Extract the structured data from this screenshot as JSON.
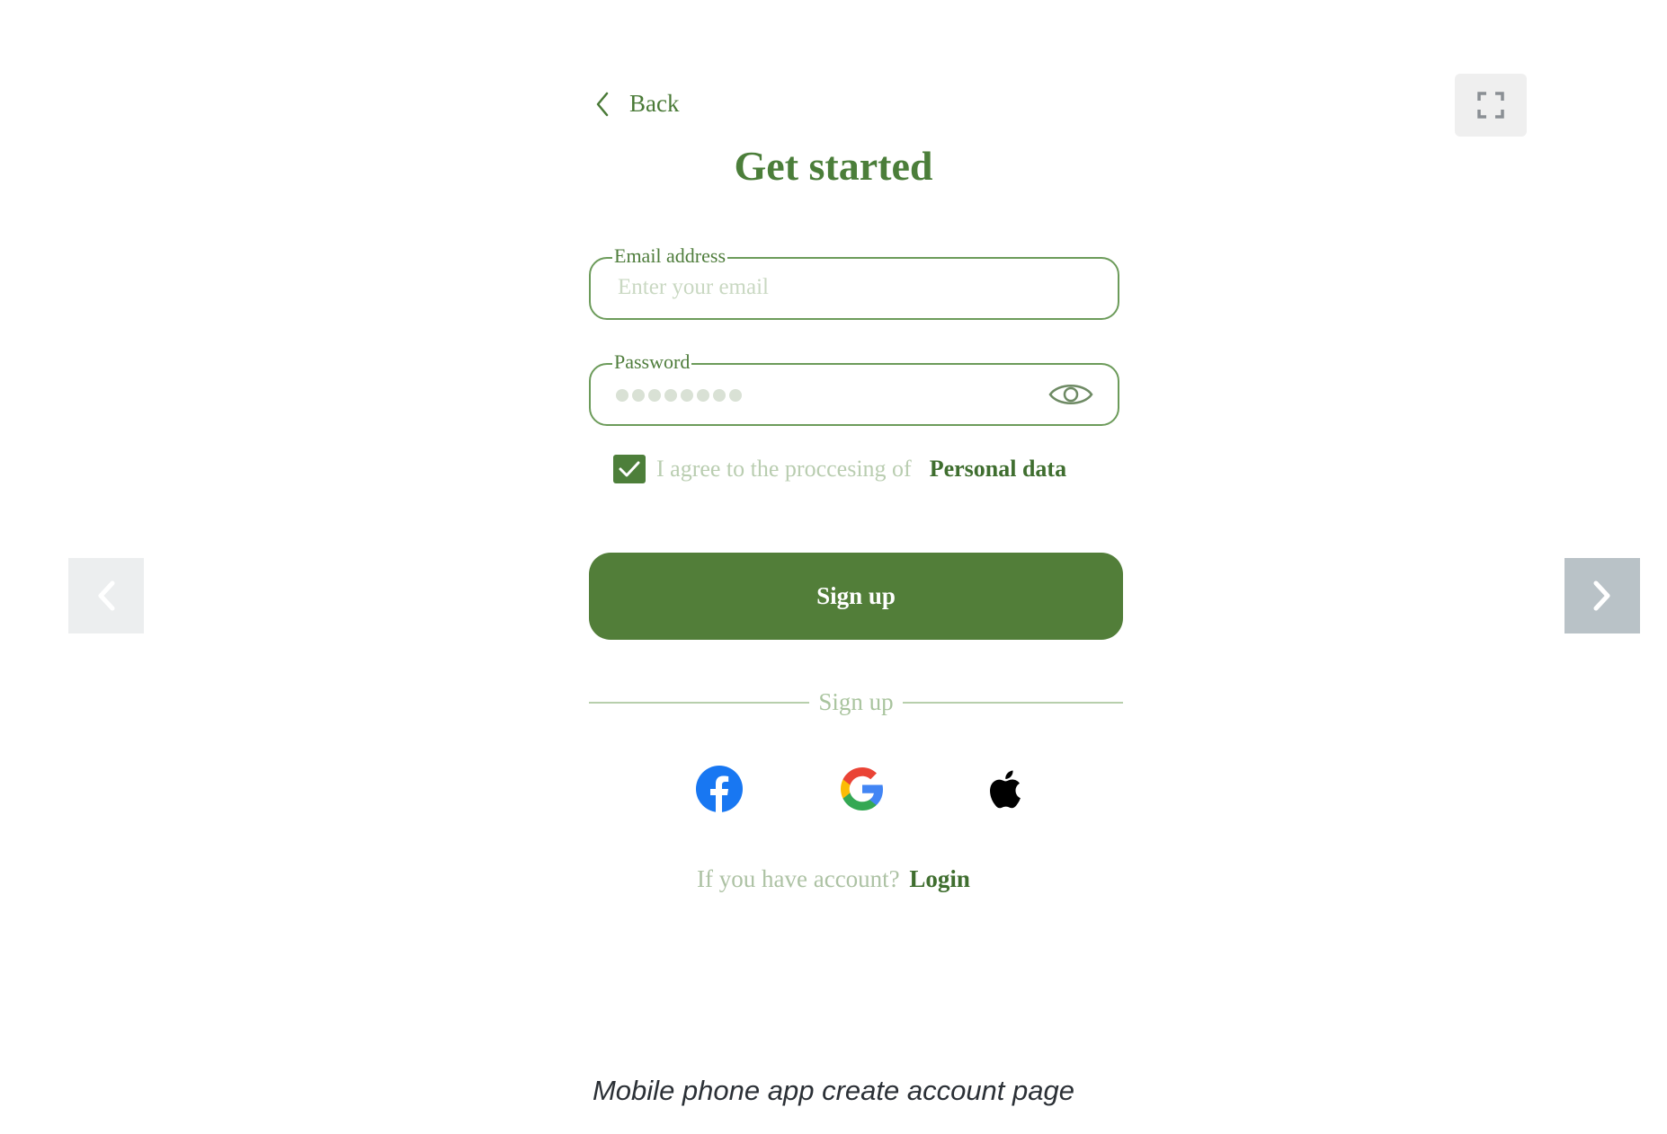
{
  "screen": {
    "back_label": "Back",
    "title": "Get started"
  },
  "email_field": {
    "label": "Email address",
    "placeholder": "Enter your email",
    "value": ""
  },
  "password_field": {
    "label": "Password",
    "masked_length": 8
  },
  "consent": {
    "checked": true,
    "text": "I agree to the proccesing of",
    "link_text": "Personal data"
  },
  "primary_button": {
    "label": "Sign up"
  },
  "divider": {
    "label": "Sign up"
  },
  "social_providers": [
    {
      "name": "facebook",
      "icon": "facebook-icon"
    },
    {
      "name": "google",
      "icon": "google-icon"
    },
    {
      "name": "apple",
      "icon": "apple-icon"
    }
  ],
  "login_prompt": {
    "text": "If you have account?",
    "link_text": "Login"
  },
  "gallery": {
    "caption": "Mobile phone app create account page",
    "fullscreen_icon": "fullscreen-icon",
    "prev_icon": "chevron-left-icon",
    "next_icon": "chevron-right-icon"
  },
  "colors": {
    "brand_green": "#527e39",
    "field_border": "#6c9b5a",
    "muted_text": "#adc2a4"
  }
}
